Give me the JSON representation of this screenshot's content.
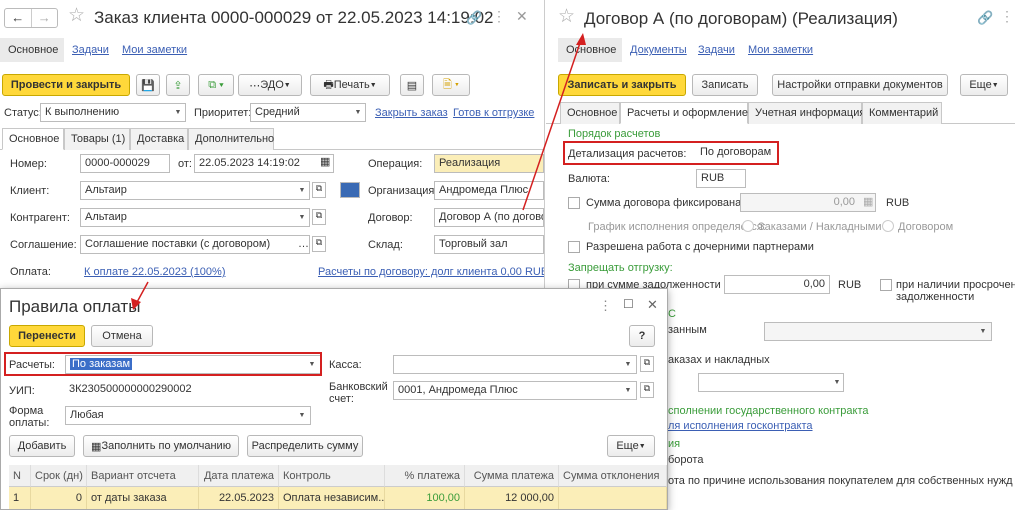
{
  "left": {
    "title": "Заказ клиента 0000-000029 от 22.05.2023 14:19:02",
    "nav": [
      "Основное",
      "Задачи",
      "Мои заметки"
    ],
    "toolbar": {
      "post_close": "Провести и закрыть",
      "edo": "ЭДО",
      "print": "Печать"
    },
    "status_label": "Статус:",
    "status_value": "К выполнению",
    "priority_label": "Приоритет:",
    "priority_value": "Средний",
    "close_order": "Закрыть заказ",
    "ready_ship": "Готов к отгрузке",
    "tabs": [
      "Основное",
      "Товары (1)",
      "Доставка",
      "Дополнительно"
    ],
    "number_label": "Номер:",
    "number_value": "0000-000029",
    "from_label": "от:",
    "date_value": "22.05.2023 14:19:02",
    "operation_label": "Операция:",
    "operation_value": "Реализация",
    "client_label": "Клиент:",
    "client_value": "Альтаир",
    "org_label": "Организация:",
    "org_value": "Андромеда Плюс",
    "counterparty_label": "Контрагент:",
    "counterparty_value": "Альтаир",
    "contract_label": "Договор:",
    "contract_value": "Договор А (по договорам)",
    "agreement_label": "Соглашение:",
    "agreement_value": "Соглашение поставки (с договором)",
    "warehouse_label": "Склад:",
    "warehouse_value": "Торговый зал",
    "payment_label": "Оплата:",
    "payment_link": "К оплате 22.05.2023 (100%)",
    "settlements_link": "Расчеты по договору: долг клиента 0,00 RUB"
  },
  "right": {
    "title": "Договор А (по договорам) (Реализация)",
    "nav": [
      "Основное",
      "Документы",
      "Задачи",
      "Мои заметки"
    ],
    "toolbar": {
      "save_close": "Записать и закрыть",
      "save": "Записать",
      "send_settings": "Настройки отправки документов",
      "more": "Еще"
    },
    "tabs": [
      "Основное",
      "Расчеты и оформление",
      "Учетная информация",
      "Комментарий"
    ],
    "settlement_order": "Порядок расчетов",
    "detail_label": "Детализация расчетов:",
    "detail_value": "По договорам",
    "currency_label": "Валюта:",
    "currency_value": "RUB",
    "fixed_sum_label": "Сумма договора фиксирована",
    "fixed_sum_value": "0,00",
    "fixed_sum_cur": "RUB",
    "schedule_label": "График исполнения определяется:",
    "schedule_opt1": "Заказами / Накладными",
    "schedule_opt2": "Договором",
    "subsidiary_label": "Разрешена работа с дочерними партнерами",
    "forbid_ship": "Запрещать отгрузку:",
    "debt_sum_label": "при сумме задолженности",
    "debt_sum_value": "0,00",
    "debt_sum_cur": "RUB",
    "overdue_label_1": "при наличии просроченно",
    "overdue_label_2": "задолженности",
    "frag_c": "С",
    "frag_bound": "занным",
    "frag_orders": "аказах и накладных",
    "frag_state_contract": "сполнении государственного контракта",
    "frag_state_link": "ля исполнения госконтракта",
    "frag_ia": "ия",
    "frag_turnover": "борота",
    "frag_reason": "ота по причине использования покупателем для собственных нужд"
  },
  "dialog": {
    "title": "Правила оплаты",
    "transfer": "Перенести",
    "cancel": "Отмена",
    "help": "?",
    "settlements_label": "Расчеты:",
    "settlements_value": "По заказам",
    "cash_label": "Касса:",
    "uip_label": "УИП:",
    "uip_value": "3К230500000000290002",
    "bank_label_1": "Банковский",
    "bank_label_2": "счет:",
    "bank_value": "0001, Андромеда Плюс",
    "form_label_1": "Форма",
    "form_label_2": "оплаты:",
    "form_value": "Любая",
    "add": "Добавить",
    "fill_default": "Заполнить по умолчанию",
    "distribute": "Распределить сумму",
    "more": "Еще",
    "columns": [
      "N",
      "Срок (дн)",
      "Вариант отсчета",
      "Дата платежа",
      "Контроль",
      "% платежа",
      "Сумма платежа",
      "Сумма отклонения"
    ],
    "row": [
      "1",
      "0",
      "от даты заказа",
      "22.05.2023",
      "Оплата независим...",
      "100,00",
      "12 000,00",
      ""
    ]
  },
  "colors": {
    "accent_yellow": "#ffd83a",
    "link_blue": "#3b5fb4",
    "highlight_red": "#d42020",
    "green_text": "#3a9c3a",
    "row_selected": "#fbeeb8"
  }
}
